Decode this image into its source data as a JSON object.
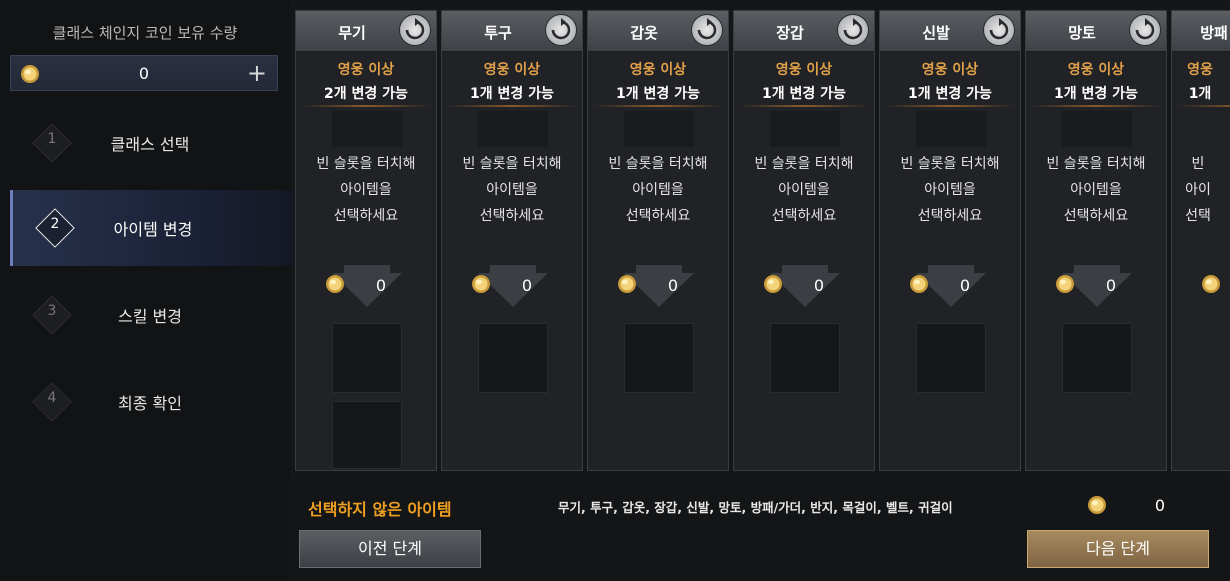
{
  "sidebar": {
    "coin_title": "클래스 체인지 코인 보유 수량",
    "coin_amount": "0",
    "coin_icon": "gold-coin-icon",
    "add_icon": "plus-icon",
    "steps": [
      {
        "num": "1",
        "label": "클래스 선택"
      },
      {
        "num": "2",
        "label": "아이템 변경",
        "active": true
      },
      {
        "num": "3",
        "label": "스킬 변경"
      },
      {
        "num": "4",
        "label": "최종 확인"
      }
    ]
  },
  "columns": [
    {
      "name": "무기",
      "grade": "영웅 이상",
      "limit": "2개 변경 가능",
      "hint": [
        "빈 슬롯을 터치해",
        "아이템을",
        "선택하세요"
      ],
      "cost": "0"
    },
    {
      "name": "투구",
      "grade": "영웅 이상",
      "limit": "1개 변경 가능",
      "hint": [
        "빈 슬롯을 터치해",
        "아이템을",
        "선택하세요"
      ],
      "cost": "0"
    },
    {
      "name": "갑옷",
      "grade": "영웅 이상",
      "limit": "1개 변경 가능",
      "hint": [
        "빈 슬롯을 터치해",
        "아이템을",
        "선택하세요"
      ],
      "cost": "0"
    },
    {
      "name": "장갑",
      "grade": "영웅 이상",
      "limit": "1개 변경 가능",
      "hint": [
        "빈 슬롯을 터치해",
        "아이템을",
        "선택하세요"
      ],
      "cost": "0"
    },
    {
      "name": "신발",
      "grade": "영웅 이상",
      "limit": "1개 변경 가능",
      "hint": [
        "빈 슬롯을 터치해",
        "아이템을",
        "선택하세요"
      ],
      "cost": "0"
    },
    {
      "name": "망토",
      "grade": "영웅 이상",
      "limit": "1개 변경 가능",
      "hint": [
        "빈 슬롯을 터치해",
        "아이템을",
        "선택하세요"
      ],
      "cost": "0"
    },
    {
      "name": "방패",
      "grade": "영웅",
      "limit": "1개",
      "hint": [
        "빈",
        "아이",
        "선택"
      ],
      "cost": ""
    }
  ],
  "bottom": {
    "unselected_title": "선택하지 않은 아이템",
    "unselected_items": "무기, 투구, 갑옷, 장갑, 신발, 망토, 방패/가더, 반지, 목걸이, 벨트, 귀걸이",
    "cost": "0",
    "prev_label": "이전 단계",
    "next_label": "다음 단계"
  },
  "colors": {
    "grade_orange": "#e0a04a",
    "unselected_orange": "#f0a020",
    "next_button_gold": "#a88a60"
  }
}
